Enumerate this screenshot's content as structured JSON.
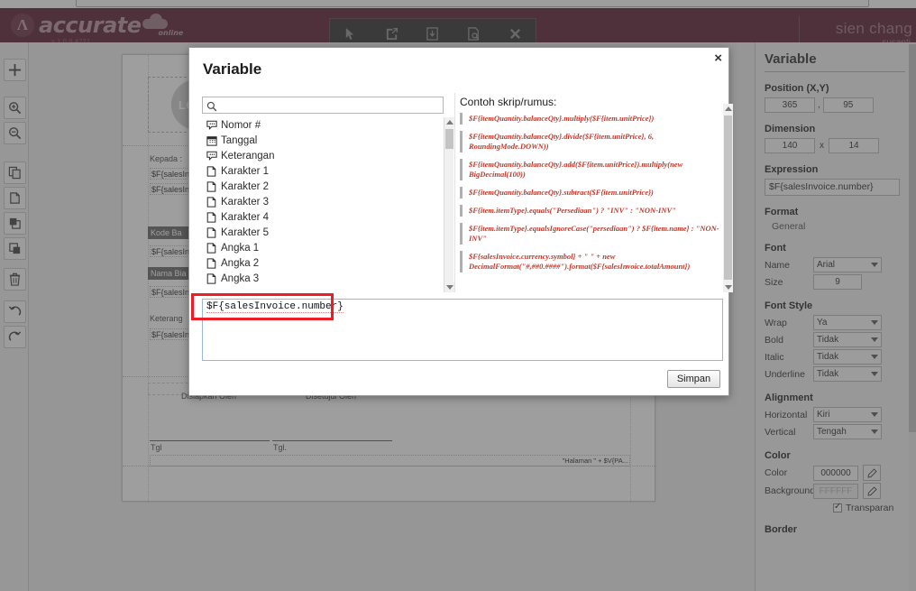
{
  "app": {
    "logo_letter": "Λ",
    "logo_name": "accurate",
    "logo_sub": "online",
    "version": "v 1.0.0.4721",
    "user_name": "sien chang",
    "user_sub": "susanti"
  },
  "header_toolbar": [
    {
      "name": "cursor-icon",
      "label": "Pilih"
    },
    {
      "name": "export-icon",
      "label": "Ekspor"
    },
    {
      "name": "import-icon",
      "label": "Impor"
    },
    {
      "name": "preview-icon",
      "label": "Pratinjau"
    },
    {
      "name": "close-icon",
      "label": "Tutup"
    }
  ],
  "left_rail": [
    {
      "name": "move-icon",
      "label": "Pindah"
    },
    {
      "name": "zoom-in-icon",
      "label": "Perbesar"
    },
    {
      "name": "zoom-out-icon",
      "label": "Perkecil"
    },
    {
      "name": "copy-icon",
      "label": "Salin"
    },
    {
      "name": "paste-icon",
      "label": "Tempel"
    },
    {
      "name": "bring-front-icon",
      "label": "Ke Depan"
    },
    {
      "name": "send-back-icon",
      "label": "Ke Belakang"
    },
    {
      "name": "trash-icon",
      "label": "Hapus"
    },
    {
      "name": "undo-icon",
      "label": "Undo"
    },
    {
      "name": "redo-icon",
      "label": "Redo"
    }
  ],
  "canvas": {
    "logo_placeholder": "LOGO",
    "labels": {
      "kepada": "Kepada :",
      "kode_barang": "Kode Ba",
      "nama_barang": "Nama Bia",
      "keterangan": "Keterang",
      "disiapkan": "Disiapkan Oleh",
      "disetujui": "Disetujui Oleh",
      "tgl1": "Tgl",
      "tgl2": "Tgl.",
      "footer": "\"Halaman \" + $V{PA..."
    },
    "fields": [
      "$F{salesIn",
      "$F{salesIn",
      "$F{salesIn",
      "$F{salesIn",
      "$F{salesIn"
    ]
  },
  "dialog": {
    "title": "Variable",
    "close_label": "×",
    "search_placeholder": "",
    "search_value": "",
    "examples_title": "Contoh skrip/rumus:",
    "save_label": "Simpan",
    "editor_value": "$F{salesInvoice.number}",
    "variables": [
      {
        "icon": "comment-icon",
        "label": "Nomor #"
      },
      {
        "icon": "calendar-icon",
        "label": "Tanggal"
      },
      {
        "icon": "comment-icon",
        "label": "Keterangan"
      },
      {
        "icon": "file-icon",
        "label": "Karakter 1"
      },
      {
        "icon": "file-icon",
        "label": "Karakter 2"
      },
      {
        "icon": "file-icon",
        "label": "Karakter 3"
      },
      {
        "icon": "file-icon",
        "label": "Karakter 4"
      },
      {
        "icon": "file-icon",
        "label": "Karakter 5"
      },
      {
        "icon": "file-icon",
        "label": "Angka 1"
      },
      {
        "icon": "file-icon",
        "label": "Angka 2"
      },
      {
        "icon": "file-icon",
        "label": "Angka 3"
      }
    ],
    "examples": [
      "$F{itemQuantity.balanceQty}.multiply($F{item.unitPrice})",
      "$F{itemQuantity.balanceQty}.divide($F{item.unitPrice}, 6, RoundingMode.DOWN))",
      "$F{itemQuantity.balanceQty}.add($F{item.unitPrice}).multiply(new BigDecimal(100))",
      "$F{itemQuantity.balanceQty}.subtract($F{item.unitPrice})",
      "$F{item.itemType}.equals(\"Persediaan\") ? \"INV\" : \"NON-INV\"",
      "$F{item.itemType}.equalsIgnoreCase(\"persediaan\") ? $F{item.name} : \"NON-INV\"",
      "$F{salesInvoice.currency.symbol} + \" \" + new DecimalFormat(\"#,##0.####\").format($F{salesInvoice.totalAmount})"
    ]
  },
  "properties": {
    "title": "Variable",
    "position_head": "Position (X,Y)",
    "position_x": "365",
    "position_y": "95",
    "position_sep": ",",
    "dimension_head": "Dimension",
    "dimension_w": "140",
    "dimension_h": "14",
    "dimension_sep": "x",
    "expression_head": "Expression",
    "expression_value": "$F{salesInvoice.number}",
    "format_head": "Format",
    "format_value": "General",
    "font_head": "Font",
    "font_name_label": "Name",
    "font_name_value": "Arial",
    "font_size_label": "Size",
    "font_size_value": "9",
    "font_style_head": "Font Style",
    "wrap_label": "Wrap",
    "wrap_value": "Ya",
    "bold_label": "Bold",
    "bold_value": "Tidak",
    "italic_label": "Italic",
    "italic_value": "Tidak",
    "underline_label": "Underline",
    "underline_value": "Tidak",
    "alignment_head": "Alignment",
    "horizontal_label": "Horizontal",
    "horizontal_value": "Kiri",
    "vertical_label": "Vertical",
    "vertical_value": "Tengah",
    "color_head": "Color",
    "color_label": "Color",
    "color_value": "000000",
    "background_label": "Background",
    "background_value": "FFFFFF",
    "transparent_label": "Transparan",
    "transparent_checked": true,
    "border_head": "Border"
  },
  "colors": {
    "header_bg": "#6e3a4b",
    "accent_red": "#ee1c25",
    "formula_red": "#c0392b",
    "panel_bg": "#f4f4f4"
  }
}
